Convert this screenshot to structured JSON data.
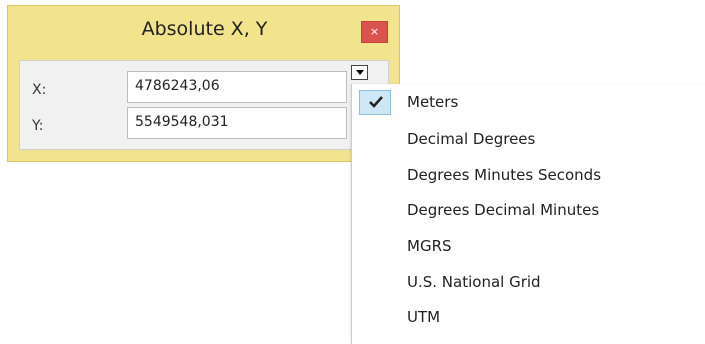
{
  "dialog": {
    "title": "Absolute X, Y",
    "close_label": "×",
    "x_label": "X:",
    "y_label": "Y:",
    "x_value": "4786243,06",
    "y_value": "5549548,031"
  },
  "unit_menu": {
    "selected": "Meters",
    "items": [
      {
        "label": "Meters",
        "checked": true
      },
      {
        "label": "Decimal Degrees",
        "checked": false
      },
      {
        "label": "Degrees Minutes Seconds",
        "checked": false
      },
      {
        "label": "Degrees Decimal Minutes",
        "checked": false
      },
      {
        "label": "MGRS",
        "checked": false
      },
      {
        "label": "U.S. National Grid",
        "checked": false
      },
      {
        "label": "UTM",
        "checked": false
      }
    ]
  },
  "colors": {
    "dialog_background": "#f2e48c",
    "close_button": "#d9534f",
    "selection_highlight": "#cde7f5"
  }
}
